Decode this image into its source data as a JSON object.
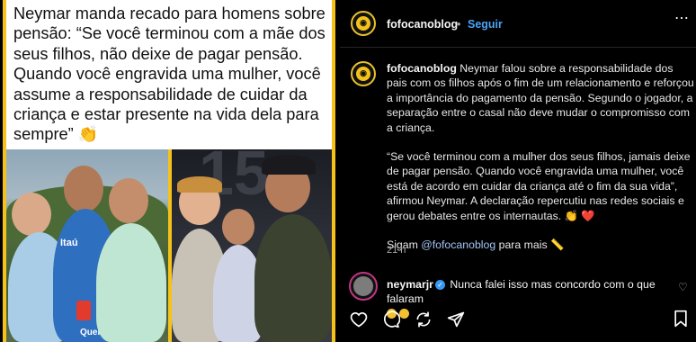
{
  "post_image": {
    "quote": "Neymar manda recado para homens sobre\npensão: “Se você terminou com a mãe dos\nseus filhos, não deixe de pagar pensão.\nQuando você engravida uma mulher, você\nassume a responsabilidade de cuidar da\ncriança e estar presente na vida dela para\nsempre” 👏",
    "shirt_text_left": "Itaú",
    "shirt_text_left2": "Quer",
    "banner_number": "15"
  },
  "header": {
    "username": "fofocanoblog",
    "separator": "•",
    "follow_label": "Seguir"
  },
  "caption": {
    "username": "fofocanoblog",
    "paragraph1": "Neymar falou sobre a responsabilidade dos pais com os filhos após o fim de um relacionamento e reforçou a importância do pagamento da pensão. Segundo o jogador, a separação entre o casal não deve mudar o compromisso com a criança.",
    "paragraph2": "“Se você terminou com a mulher dos seus filhos, jamais deixe de pagar pensão. Quando você engravida uma mulher, você está de acordo em cuidar da criança até o fim da sua vida”, afirmou Neymar. A declaração repercutiu nas redes sociais e gerou debates entre os internautas. 👏 ❤️",
    "follow_prefix": "Sigam ",
    "follow_mention": "@fofocanoblog",
    "follow_suffix": " para mais 📏",
    "time": "21 h"
  },
  "comment": {
    "username": "neymarjr",
    "text": "Nunca falei isso mas concordo com o que falaram",
    "verified": "✓"
  },
  "actions": [
    "like-icon",
    "comment-icon",
    "share-icon",
    "send-icon"
  ],
  "colors": {
    "accent_frame": "#f4c21a",
    "link": "#4aa3f5",
    "background": "#000000"
  }
}
